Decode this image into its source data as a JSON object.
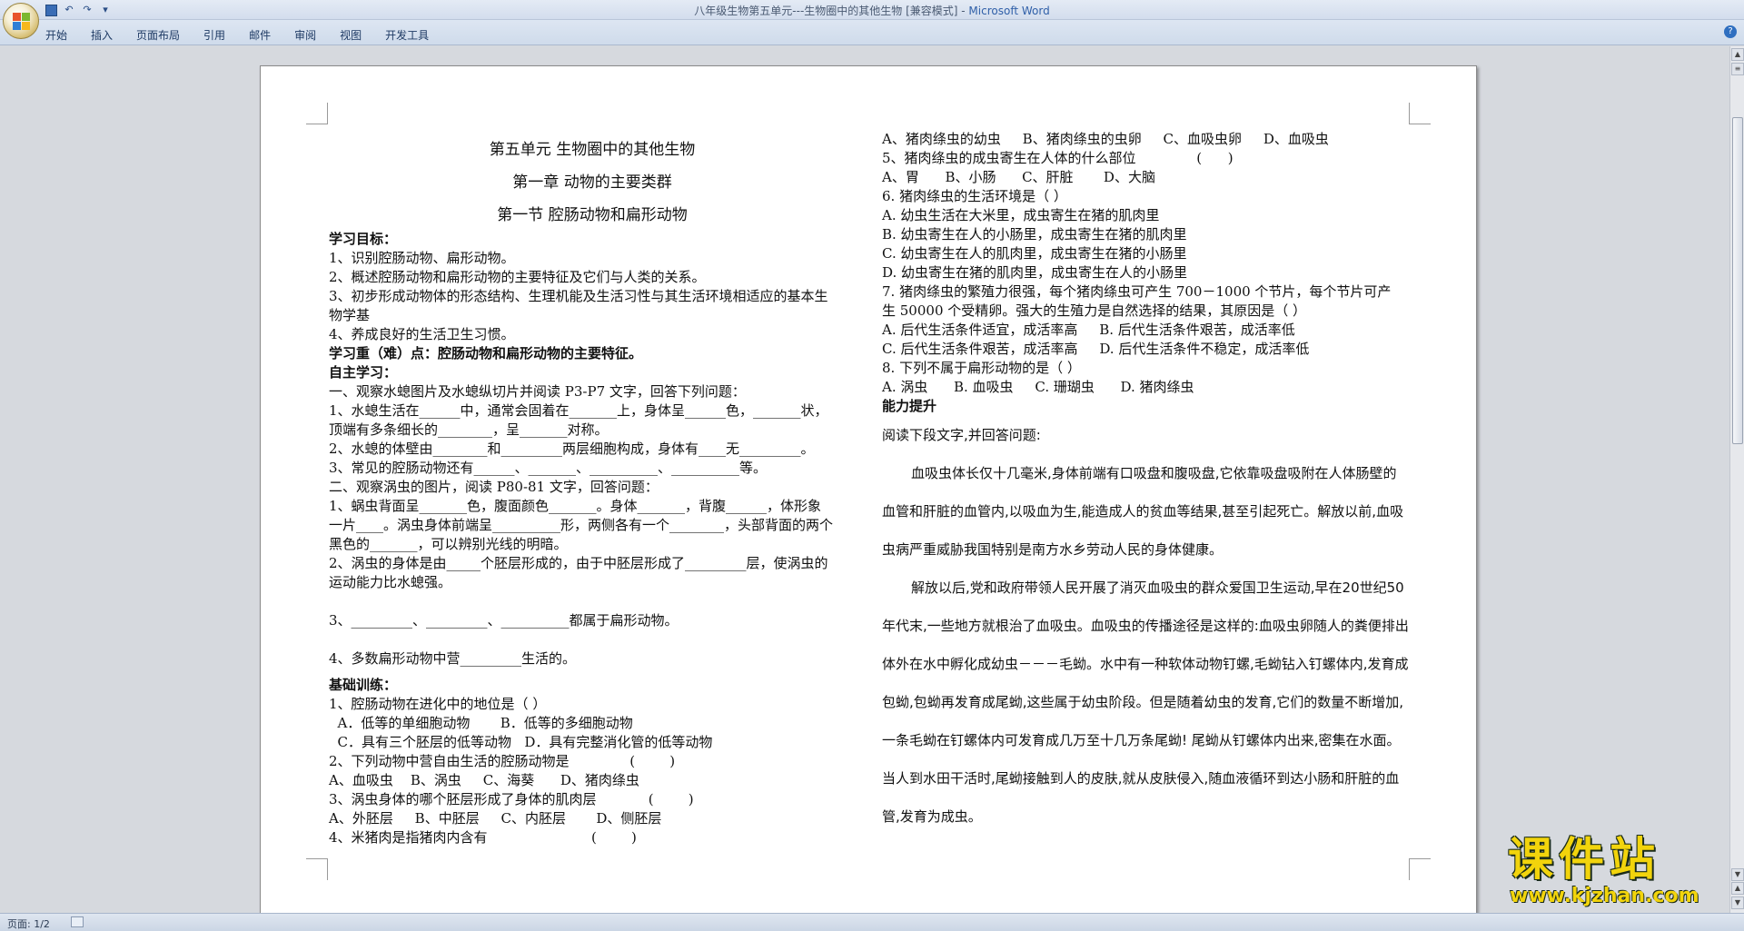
{
  "window": {
    "title": "八年级生物第五单元---生物圈中的其他生物 [兼容模式] - ",
    "app_name": "Microsoft Word"
  },
  "ribbon_tabs": [
    "开始",
    "插入",
    "页面布局",
    "引用",
    "邮件",
    "审阅",
    "视图",
    "开发工具"
  ],
  "qat": {
    "save": "save-icon",
    "undo": "↶",
    "redo": "↷",
    "more": "▾"
  },
  "help": "?",
  "status": {
    "page": "页面: 1/2"
  },
  "watermark": {
    "text": "课件站",
    "url": "www.kjzhan.com"
  },
  "left_column": [
    "第五单元    生物圈中的其他生物",
    "第一章 动物的主要类群",
    "第一节 腔肠动物和扁形动物",
    "学习目标：",
    "1、识别腔肠动物、扁形动物。",
    "2、概述腔肠动物和扁形动物的主要特征及它们与人类的关系。",
    "3、初步形成动物体的形态结构、生理机能及生活习性与其生活环境相适应的基本生",
    "物学基",
    "4、养成良好的生活卫生习惯。",
    "学习重（难）点：腔肠动物和扁形动物的主要特征。",
    "自主学习：",
    "一、观察水螅图片及水螅纵切片并阅读 P3-P7 文字，回答下列问题：",
    "1、水螅生活在______中，通常会固着在_______上，身体呈______色，_______状，",
    "顶端有多条细长的________，呈_______对称。",
    "2、水螅的体壁由________和_________两层细胞构成，身体有____无_________。",
    "3、常见的腔肠动物还有______、_______、__________、__________等。",
    "二、观察涡虫的图片，阅读 P80-81 文字，回答问题：",
    "1、蜗虫背面呈_______色，腹面颜色_______。身体_______，背腹______，体形象",
    "一片____。涡虫身体前端呈__________形，两侧各有一个________，头部背面的两个",
    "黑色的_______，可以辨别光线的明暗。",
    "2、涡虫的身体是由_____个胚层形成的，由于中胚层形成了_________层，使涡虫的",
    "运动能力比水螅强。",
    "3、_________、_________、__________都属于扁形动物。",
    "4、多数扁形动物中营_________生活的。",
    "基础训练：",
    "1、腔肠动物在进化中的地位是（  ）",
    "  A．低等的单细胞动物       B．低等的多细胞动物",
    "  C．具有三个胚层的低等动物   D．具有完整消化管的低等动物",
    "2、下列动物中营自由生活的腔肠动物是              (        )",
    "A、血吸虫    B、涡虫     C、海葵      D、猪肉绦虫",
    "3、涡虫身体的哪个胚层形成了身体的肌肉层            (        )",
    "A、外胚层     B、中胚层     C、内胚层       D、侧胚层",
    "4、米猪肉是指猪肉内含有                        (        )"
  ],
  "right_column": [
    "A、猪肉绦虫的幼虫     B、猪肉绦虫的虫卵     C、血吸虫卵     D、血吸虫",
    "5、猪肉绦虫的成虫寄生在人体的什么部位              (      )",
    "A、胃      B、小肠      C、肝脏       D、大脑",
    "6. 猪肉绦虫的生活环境是（  ）",
    "A. 幼虫生活在大米里，成虫寄生在猪的肌肉里",
    "B. 幼虫寄生在人的小肠里，成虫寄生在猪的肌肉里",
    "C. 幼虫寄生在人的肌肉里，成虫寄生在猪的小肠里",
    "D. 幼虫寄生在猪的肌肉里，成虫寄生在人的小肠里",
    "7. 猪肉绦虫的繁殖力很强，每个猪肉绦虫可产生 700－1000 个节片，每个节片可产",
    "生 50000 个受精卵。强大的生殖力是自然选择的结果，其原因是（  ）",
    "A. 后代生活条件适宜，成活率高     B. 后代生活条件艰苦，成活率低",
    "C. 后代生活条件艰苦，成活率高     D. 后代生活条件不稳定，成活率低",
    "8. 下列不属于扁形动物的是（  ）",
    "A. 涡虫      B. 血吸虫     C. 珊瑚虫      D. 猪肉绦虫",
    "能力提升",
    "阅读下段文字,并回答问题:"
  ],
  "passage": [
    "血吸虫体长仅十几毫米,身体前端有口吸盘和腹吸盘,它依靠吸盘吸附在人体肠壁的血管和肝脏的血管内,以吸血为生,能造成人的贫血等结果,甚至引起死亡。解放以前,血吸虫病严重威胁我国特别是南方水乡劳动人民的身体健康。",
    "解放以后,党和政府带领人民开展了消灭血吸虫的群众爱国卫生运动,早在20世纪50年代末,一些地方就根治了血吸虫。血吸虫的传播途径是这样的:血吸虫卵随人的粪便排出体外在水中孵化成幼虫－－－毛蚴。水中有一种软体动物钉螺,毛蚴钻入钉螺体内,发育成包蚴,包蚴再发育成尾蚴,这些属于幼虫阶段。但是随着幼虫的发育,它们的数量不断增加,一条毛蚴在钉螺体内可发育成几万至十几万条尾蚴! 尾蚴从钉螺体内出来,密集在水面。当人到水田干活时,尾蚴接触到人的皮肤,就从皮肤侵入,随血液循环到达小肠和肝脏的血管,发育为成虫。"
  ]
}
